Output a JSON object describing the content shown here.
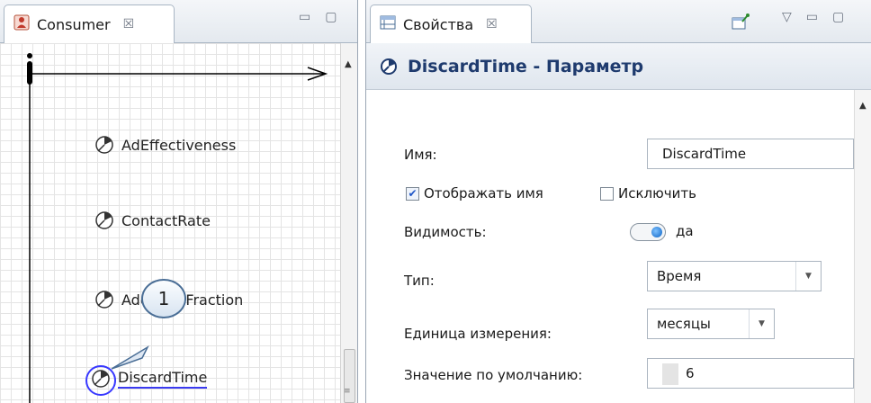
{
  "left_view": {
    "tab_label": "Consumer",
    "tab_close": "☒",
    "minimize": "▭",
    "maximize": "▢"
  },
  "diagram": {
    "parameters": [
      {
        "name": "AdEffectiveness"
      },
      {
        "name": "ContactRate"
      },
      {
        "name": "AdoptionFraction"
      },
      {
        "name": "DiscardTime"
      }
    ],
    "callout_number": "1"
  },
  "right_view": {
    "tab_label": "Свойства",
    "tab_close": "☒",
    "view_menu": "▽",
    "minimize": "▭",
    "maximize": "▢"
  },
  "properties": {
    "title": "DiscardTime - Параметр",
    "name_label": "Имя:",
    "name_value": "DiscardTime",
    "show_name_label": "Отображать имя",
    "show_name_checked": true,
    "exclude_label": "Исключить",
    "exclude_checked": false,
    "visibility_label": "Видимость:",
    "visibility_value": "да",
    "type_label": "Тип:",
    "type_value": "Время",
    "unit_label": "Единица измерения:",
    "unit_value": "месяцы",
    "default_label": "Значение по умолчанию:",
    "default_value": "6"
  },
  "colors": {
    "header_text": "#1f3b6e",
    "selection": "#3838ff",
    "checkbox_check": "#1f56c7",
    "toggle_knob": "#0b62c4"
  }
}
